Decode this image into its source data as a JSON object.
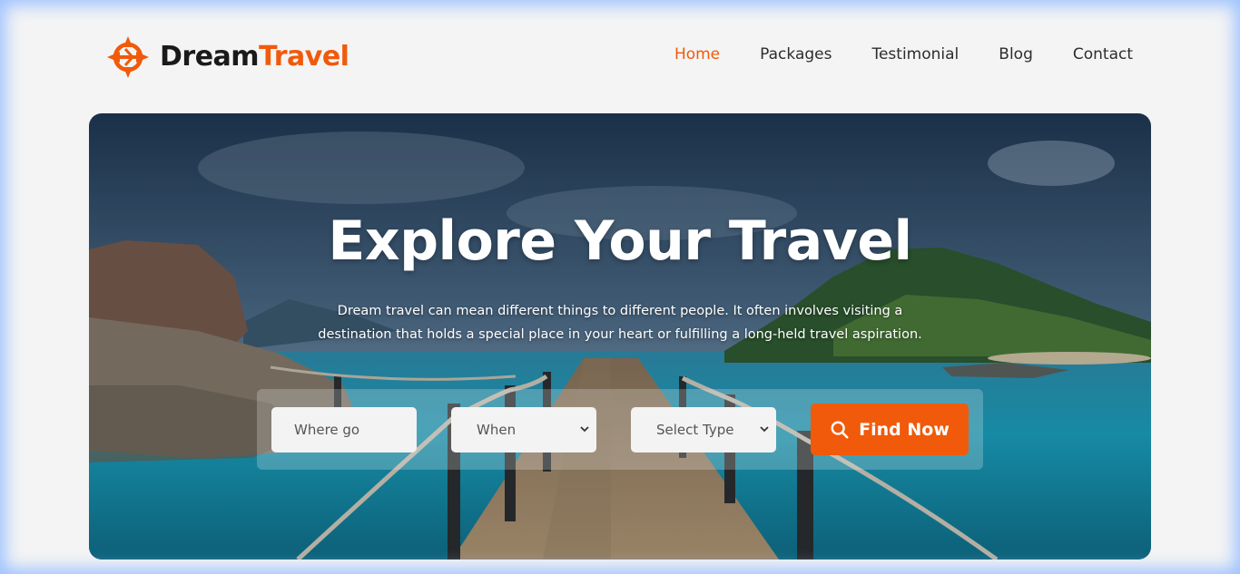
{
  "brand": {
    "name_part1": "Dream",
    "name_part2": "Travel",
    "accent_color": "#f05a0a",
    "logo_icon": "compass-plane-icon"
  },
  "nav": {
    "items": [
      {
        "label": "Home",
        "active": true
      },
      {
        "label": "Packages",
        "active": false
      },
      {
        "label": "Testimonial",
        "active": false
      },
      {
        "label": "Blog",
        "active": false
      },
      {
        "label": "Contact",
        "active": false
      }
    ]
  },
  "hero": {
    "title": "Explore Your Travel",
    "description": "Dream travel can mean different things to different people. It often involves visiting a destination that holds a special place in your heart or fulfilling a long-held travel aspiration."
  },
  "search": {
    "where_placeholder": "Where go",
    "when_selected": "When",
    "type_selected": "Select Type",
    "button_label": "Find Now",
    "button_icon": "search-icon"
  }
}
